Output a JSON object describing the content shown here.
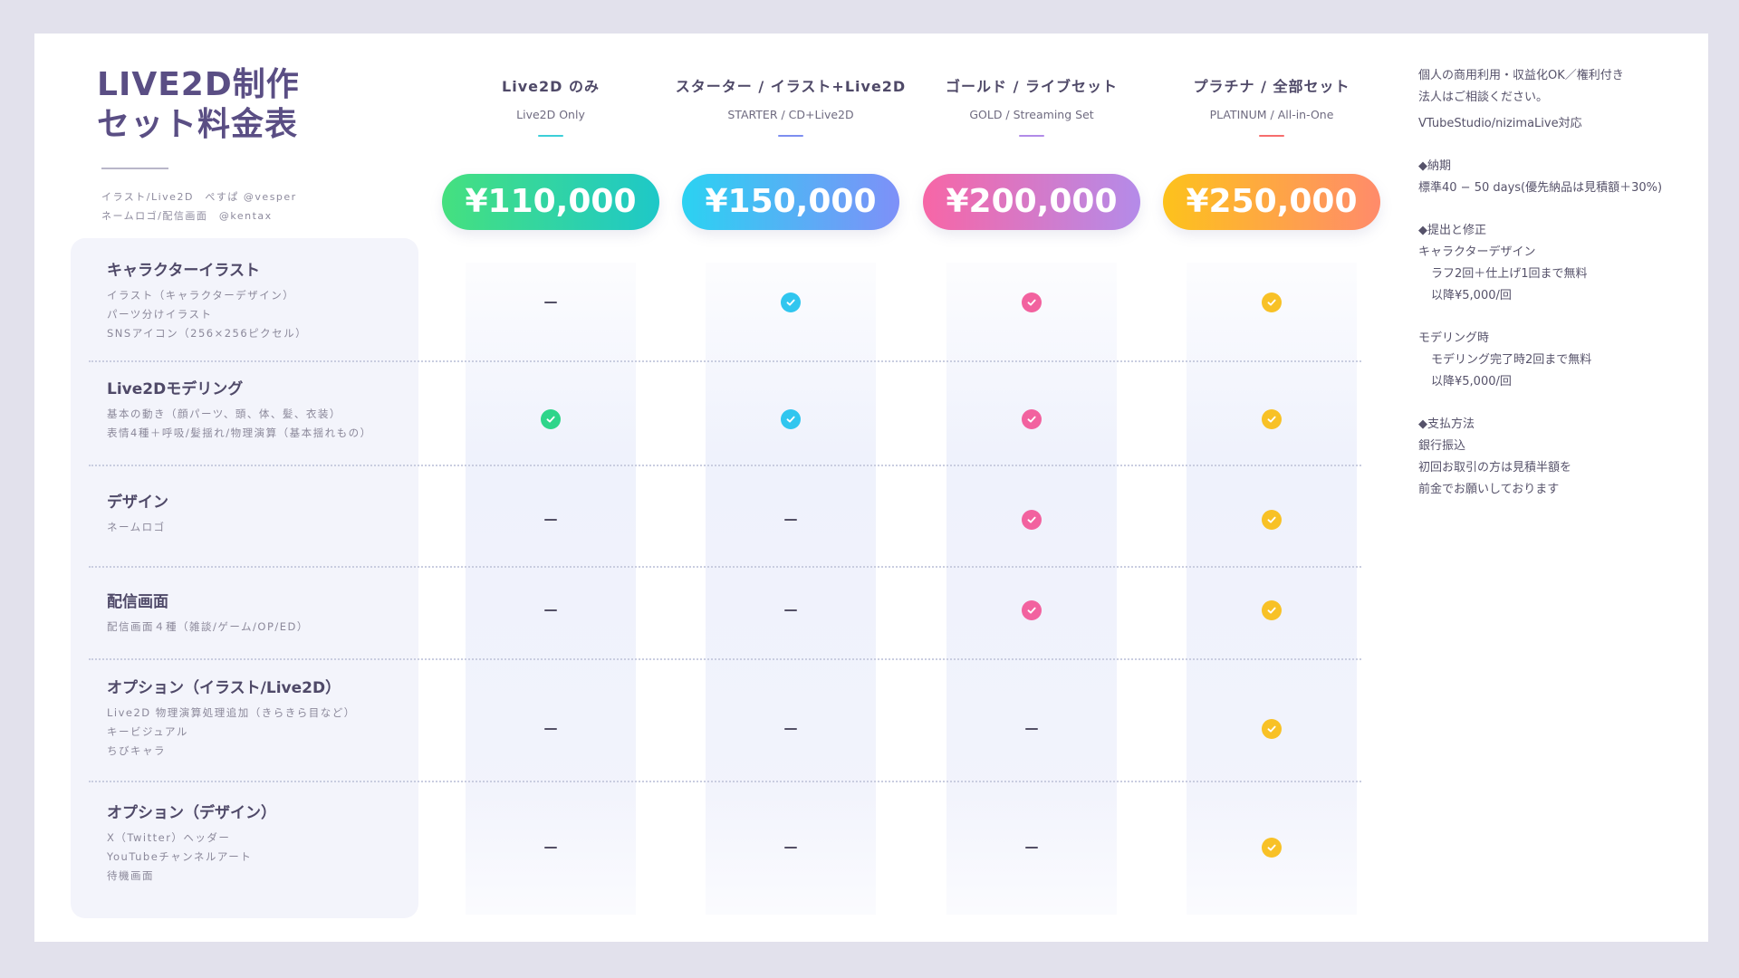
{
  "title": {
    "line1": "LIVE2D制作",
    "line2": "セット料金表"
  },
  "credits": {
    "line1": "イラスト/Live2D　ぺすぱ @vesper",
    "line2": "ネームロゴ/配信画面　@kentax"
  },
  "plans": [
    {
      "name": "Live2D のみ",
      "sub": "Live2D Only",
      "price": "¥110,000",
      "accent": "#3ccfd8",
      "gradient": [
        "#45e07f",
        "#1ec8c8"
      ],
      "check_color": "#2ed58a"
    },
    {
      "name": "スターター / イラスト+Live2D",
      "sub": "STARTER / CD+Live2D",
      "price": "¥150,000",
      "accent": "#7d8ef0",
      "gradient": [
        "#2bd2f2",
        "#7e90f8"
      ],
      "check_color": "#30c6ef"
    },
    {
      "name": "ゴールド / ライブセット",
      "sub": "GOLD / Streaming Set",
      "price": "¥200,000",
      "accent": "#b18be8",
      "gradient": [
        "#f766a6",
        "#b48be9"
      ],
      "check_color": "#f2629f"
    },
    {
      "name": "プラチナ / 全部セット",
      "sub": "PLATINUM / All-in-One",
      "price": "¥250,000",
      "accent": "#f66d6d",
      "gradient": [
        "#fdc21c",
        "#ff8b6b"
      ],
      "check_color": "#f8c126"
    }
  ],
  "rows": [
    {
      "title": "キャラクターイラスト",
      "desc": [
        "イラスト（キャラクターデザイン）",
        "パーツ分けイラスト",
        "SNSアイコン（256×256ピクセル）"
      ],
      "included": [
        false,
        true,
        true,
        true
      ]
    },
    {
      "title": "Live2Dモデリング",
      "desc": [
        "基本の動き（顔パーツ、頭、体、髪、衣装）",
        "表情4種＋呼吸/髪揺れ/物理演算（基本揺れもの）"
      ],
      "included": [
        true,
        true,
        true,
        true
      ]
    },
    {
      "title": "デザイン",
      "desc": [
        "ネームロゴ"
      ],
      "included": [
        false,
        false,
        true,
        true
      ]
    },
    {
      "title": "配信画面",
      "desc": [
        "配信画面４種（雑談/ゲーム/OP/ED）"
      ],
      "included": [
        false,
        false,
        true,
        true
      ]
    },
    {
      "title": "オプション（イラスト/Live2D）",
      "desc": [
        "Live2D 物理演算処理追加（きらきら目など）",
        "キービジュアル",
        "ちびキャラ"
      ],
      "included": [
        false,
        false,
        false,
        true
      ]
    },
    {
      "title": "オプション（デザイン）",
      "desc": [
        "X（Twitter）ヘッダー",
        "YouTubeチャンネルアート",
        "待機画面"
      ],
      "included": [
        false,
        false,
        false,
        true
      ]
    }
  ],
  "notes": {
    "commercial": [
      "個人の商用利用・収益化OK／権利付き",
      "法人はご相談ください。"
    ],
    "support": "VTubeStudio/nizimaLive対応",
    "delivery": {
      "heading": "◆納期",
      "text": "標準40 − 50 days(優先納品は見積額＋30%)"
    },
    "revision": {
      "heading": "◆提出と修正",
      "character_title": "キャラクターデザイン",
      "character_lines": [
        "ラフ2回＋仕上げ1回まで無料",
        "以降¥5,000/回"
      ],
      "modeling_title": "モデリング時",
      "modeling_lines": [
        "モデリング完了時2回まで無料",
        "以降¥5,000/回"
      ]
    },
    "payment": {
      "heading": "◆支払方法",
      "lines": [
        "銀行振込",
        "初回お取引の方は見積半額を",
        "前金でお願いしております"
      ]
    }
  }
}
